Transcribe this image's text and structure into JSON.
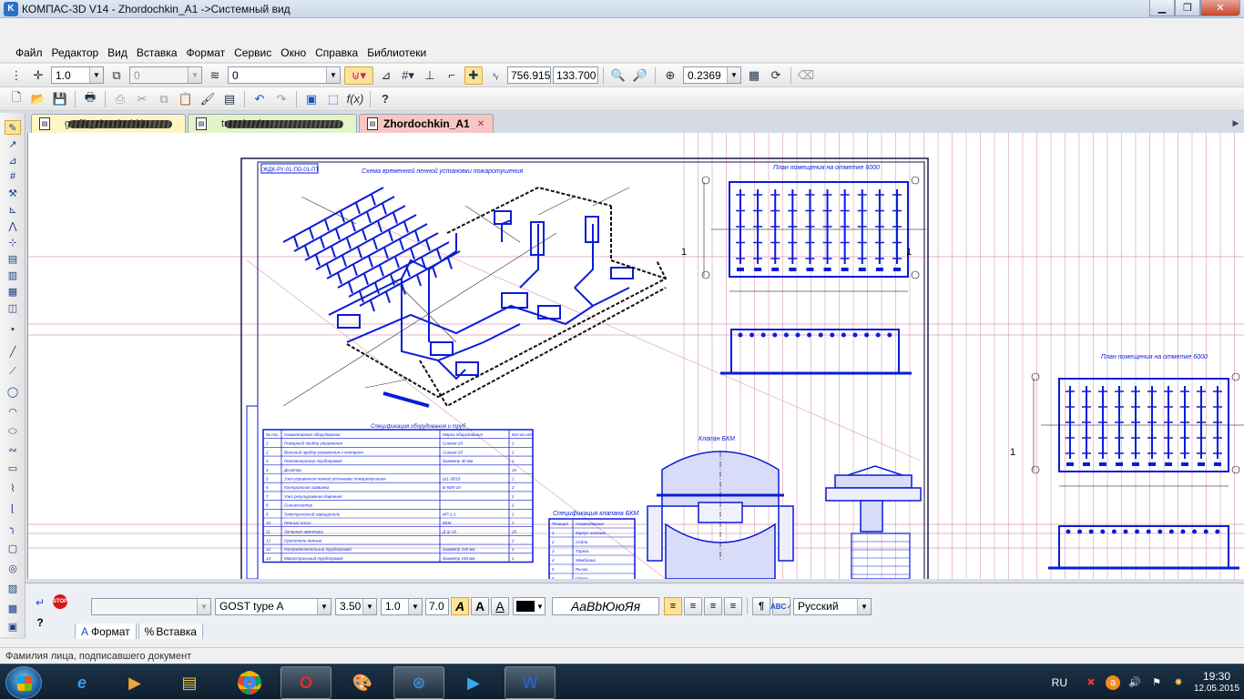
{
  "window": {
    "title": "КОМПАС-3D V14 - Zhordochkin_A1 ->Системный вид",
    "logo_glyph": "K",
    "minimize_glyph": "▁",
    "maximize_glyph": "❐",
    "close_glyph": "✕"
  },
  "menu": [
    "Файл",
    "Редактор",
    "Вид",
    "Вставка",
    "Формат",
    "Сервис",
    "Окно",
    "Справка",
    "Библиотеки"
  ],
  "toolbar_view": {
    "line_scale": "1.0",
    "layer_number": "0",
    "style_value": "0",
    "coord_x": "756.9150",
    "coord_y": "133.700",
    "zoom": "0.2369"
  },
  "doc_tabs": [
    {
      "label": "grafik_zhordochkin",
      "color": "#fff6c4"
    },
    {
      "label": "trassirovka",
      "color": "#e4f3c8"
    },
    {
      "label": "Zhordochkin_A1",
      "color": "#f7c6c2",
      "active": true
    }
  ],
  "drawing": {
    "title_scheme": "Схема временной пенной установки пожаротушения",
    "title_plan_1": "План помещения на отметке 6000",
    "title_plan_2": "План помещения на отметке 6000",
    "title_spec": "Спецификация оборудования и труб",
    "title_valve": "Клапан БКМ",
    "title_spec_valve": "Спецификация клапана БКМ",
    "stamp": "ЖДК-РУ-01-ПО-01-ПТ",
    "marker_1": "1",
    "marker_2": "1",
    "marker_3": "1",
    "spec_headers": [
      "№ поз.",
      "Наименование оборудования",
      "Марка оборудования",
      "Кол-во шт."
    ],
    "spec_rows": [
      [
        "1",
        "Пожарный прибор управления",
        "Сигнал-20",
        "1"
      ],
      [
        "2",
        "Внешний прибор управления и контроля",
        "Сигнал-20",
        "1"
      ],
      [
        "3",
        "Пеногенератор трубопровод",
        "диаметр 40 мм",
        "1"
      ],
      [
        "4",
        "Дозатор",
        "",
        "10"
      ],
      [
        "5",
        "Узел управления пенной установки пожаротушения",
        "Ш1-30/10",
        "2"
      ],
      [
        "6",
        "Контрольная задвижка",
        "Б-50/0-10",
        "2"
      ],
      [
        "7",
        "Узел регулирования давления",
        "",
        "1"
      ],
      [
        "8",
        "Сигнализатор",
        "",
        "1"
      ],
      [
        "9",
        "Электрический извещатель",
        "ИП-1-1",
        "1"
      ],
      [
        "10",
        "Пенный насос",
        "БКМ",
        "1"
      ],
      [
        "11",
        "Запорная арматура",
        "Д Ш-10",
        "20"
      ],
      [
        "12",
        "Оросители пенные",
        "",
        "2"
      ],
      [
        "13",
        "Распределительный трубопровод",
        "диаметр 100 мм",
        "1"
      ],
      [
        "14",
        "Магистральный трубопровод",
        "диаметр 150 мм",
        "1"
      ]
    ],
    "valve_spec_headers": [
      "Позиция",
      "Наименование"
    ],
    "valve_spec_rows": [
      [
        "1",
        "Корпус клапана"
      ],
      [
        "2",
        "Седло"
      ],
      [
        "3",
        "Тарель"
      ],
      [
        "4",
        "Мембрана"
      ],
      [
        "5",
        "Рычаг"
      ],
      [
        "6",
        "Опора"
      ]
    ]
  },
  "properties": {
    "style_combo": "",
    "font": "GOST type A",
    "height": "3.50",
    "narrowing": "1.0",
    "step": "7.0",
    "sample": "АаВbЮюЯя",
    "language": "Русский",
    "tab_format": "Формат",
    "tab_insert": "Вставка",
    "stop_label": "STOP"
  },
  "status": {
    "text": "Фамилия лица, подписавшего документ"
  },
  "taskbar": {
    "language": "RU",
    "clock_time": "19:30",
    "clock_date": "12.05.2015"
  },
  "colors": {
    "drawing_blue": "#0a1cd8",
    "grid_pink": "#d89bb4",
    "line_dark": "#1a1a4a"
  }
}
